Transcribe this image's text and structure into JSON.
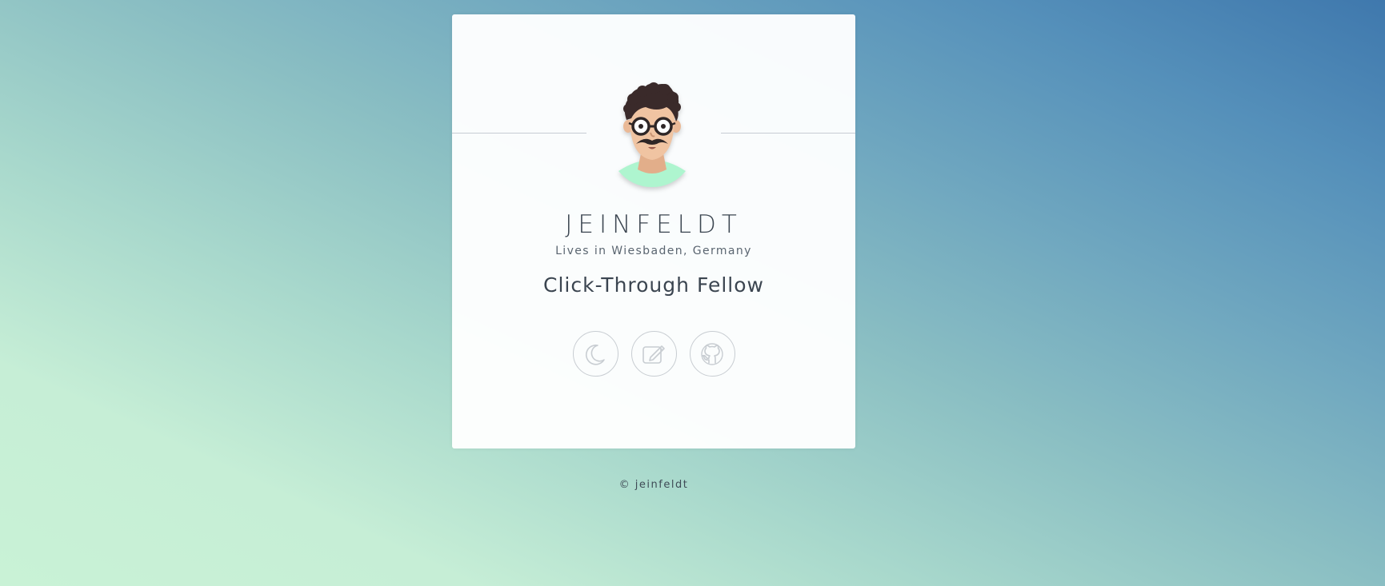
{
  "profile": {
    "name": "JEINFELDT",
    "location": "Lives in Wiesbaden, Germany",
    "role": "Click-Through Fellow"
  },
  "actions": [
    {
      "icon": "moon-icon",
      "label": "dark mode"
    },
    {
      "icon": "edit-icon",
      "label": "blog"
    },
    {
      "icon": "github-icon",
      "label": "github"
    }
  ],
  "footer": {
    "copyright": "© jeinfeldt"
  },
  "colors": {
    "background_start": "#c9f2d6",
    "background_end": "#3f78ad",
    "card": "#fafbfc",
    "text": "#3b4550",
    "icon_stroke": "#c8cdd2",
    "shirt": "#aef5cf"
  }
}
